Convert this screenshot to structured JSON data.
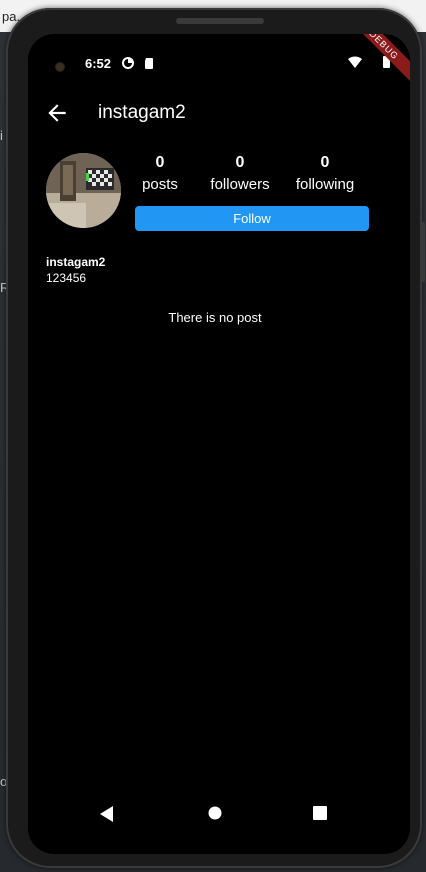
{
  "host": {
    "tab_text": "pa...",
    "side_letters": [
      "i",
      "R",
      "o"
    ]
  },
  "status_bar": {
    "time": "6:52",
    "debug_banner": "DEBUG"
  },
  "app_bar": {
    "title": "instagam2"
  },
  "profile": {
    "stats": [
      {
        "value": "0",
        "label": "posts"
      },
      {
        "value": "0",
        "label": "followers"
      },
      {
        "value": "0",
        "label": "following"
      }
    ],
    "follow_label": "Follow",
    "username": "instagam2",
    "bio": "123456"
  },
  "posts": {
    "empty_message": "There is no post"
  },
  "colors": {
    "accent": "#2196f3",
    "background": "#000000",
    "debug_ribbon": "#8b1a1a"
  }
}
